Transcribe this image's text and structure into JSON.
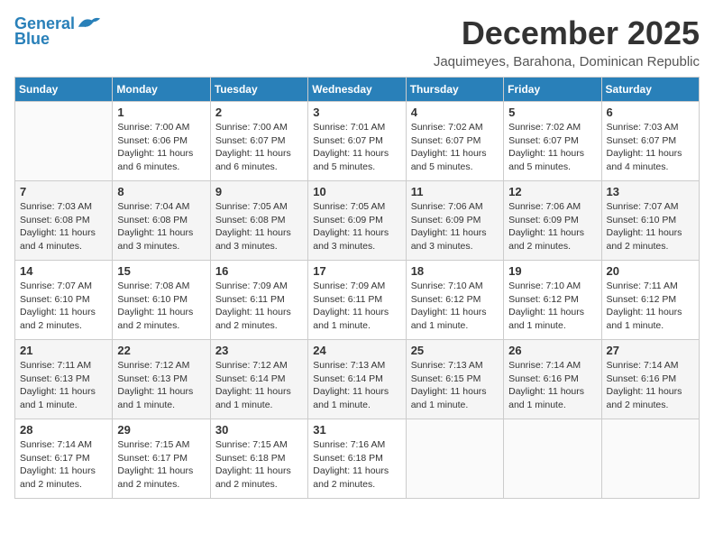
{
  "logo": {
    "line1": "General",
    "line2": "Blue"
  },
  "title": "December 2025",
  "subtitle": "Jaquimeyes, Barahona, Dominican Republic",
  "days_header": [
    "Sunday",
    "Monday",
    "Tuesday",
    "Wednesday",
    "Thursday",
    "Friday",
    "Saturday"
  ],
  "weeks": [
    [
      {
        "day": "",
        "info": ""
      },
      {
        "day": "1",
        "info": "Sunrise: 7:00 AM\nSunset: 6:06 PM\nDaylight: 11 hours\nand 6 minutes."
      },
      {
        "day": "2",
        "info": "Sunrise: 7:00 AM\nSunset: 6:07 PM\nDaylight: 11 hours\nand 6 minutes."
      },
      {
        "day": "3",
        "info": "Sunrise: 7:01 AM\nSunset: 6:07 PM\nDaylight: 11 hours\nand 5 minutes."
      },
      {
        "day": "4",
        "info": "Sunrise: 7:02 AM\nSunset: 6:07 PM\nDaylight: 11 hours\nand 5 minutes."
      },
      {
        "day": "5",
        "info": "Sunrise: 7:02 AM\nSunset: 6:07 PM\nDaylight: 11 hours\nand 5 minutes."
      },
      {
        "day": "6",
        "info": "Sunrise: 7:03 AM\nSunset: 6:07 PM\nDaylight: 11 hours\nand 4 minutes."
      }
    ],
    [
      {
        "day": "7",
        "info": "Sunrise: 7:03 AM\nSunset: 6:08 PM\nDaylight: 11 hours\nand 4 minutes."
      },
      {
        "day": "8",
        "info": "Sunrise: 7:04 AM\nSunset: 6:08 PM\nDaylight: 11 hours\nand 3 minutes."
      },
      {
        "day": "9",
        "info": "Sunrise: 7:05 AM\nSunset: 6:08 PM\nDaylight: 11 hours\nand 3 minutes."
      },
      {
        "day": "10",
        "info": "Sunrise: 7:05 AM\nSunset: 6:09 PM\nDaylight: 11 hours\nand 3 minutes."
      },
      {
        "day": "11",
        "info": "Sunrise: 7:06 AM\nSunset: 6:09 PM\nDaylight: 11 hours\nand 3 minutes."
      },
      {
        "day": "12",
        "info": "Sunrise: 7:06 AM\nSunset: 6:09 PM\nDaylight: 11 hours\nand 2 minutes."
      },
      {
        "day": "13",
        "info": "Sunrise: 7:07 AM\nSunset: 6:10 PM\nDaylight: 11 hours\nand 2 minutes."
      }
    ],
    [
      {
        "day": "14",
        "info": "Sunrise: 7:07 AM\nSunset: 6:10 PM\nDaylight: 11 hours\nand 2 minutes."
      },
      {
        "day": "15",
        "info": "Sunrise: 7:08 AM\nSunset: 6:10 PM\nDaylight: 11 hours\nand 2 minutes."
      },
      {
        "day": "16",
        "info": "Sunrise: 7:09 AM\nSunset: 6:11 PM\nDaylight: 11 hours\nand 2 minutes."
      },
      {
        "day": "17",
        "info": "Sunrise: 7:09 AM\nSunset: 6:11 PM\nDaylight: 11 hours\nand 1 minute."
      },
      {
        "day": "18",
        "info": "Sunrise: 7:10 AM\nSunset: 6:12 PM\nDaylight: 11 hours\nand 1 minute."
      },
      {
        "day": "19",
        "info": "Sunrise: 7:10 AM\nSunset: 6:12 PM\nDaylight: 11 hours\nand 1 minute."
      },
      {
        "day": "20",
        "info": "Sunrise: 7:11 AM\nSunset: 6:12 PM\nDaylight: 11 hours\nand 1 minute."
      }
    ],
    [
      {
        "day": "21",
        "info": "Sunrise: 7:11 AM\nSunset: 6:13 PM\nDaylight: 11 hours\nand 1 minute."
      },
      {
        "day": "22",
        "info": "Sunrise: 7:12 AM\nSunset: 6:13 PM\nDaylight: 11 hours\nand 1 minute."
      },
      {
        "day": "23",
        "info": "Sunrise: 7:12 AM\nSunset: 6:14 PM\nDaylight: 11 hours\nand 1 minute."
      },
      {
        "day": "24",
        "info": "Sunrise: 7:13 AM\nSunset: 6:14 PM\nDaylight: 11 hours\nand 1 minute."
      },
      {
        "day": "25",
        "info": "Sunrise: 7:13 AM\nSunset: 6:15 PM\nDaylight: 11 hours\nand 1 minute."
      },
      {
        "day": "26",
        "info": "Sunrise: 7:14 AM\nSunset: 6:16 PM\nDaylight: 11 hours\nand 1 minute."
      },
      {
        "day": "27",
        "info": "Sunrise: 7:14 AM\nSunset: 6:16 PM\nDaylight: 11 hours\nand 2 minutes."
      }
    ],
    [
      {
        "day": "28",
        "info": "Sunrise: 7:14 AM\nSunset: 6:17 PM\nDaylight: 11 hours\nand 2 minutes."
      },
      {
        "day": "29",
        "info": "Sunrise: 7:15 AM\nSunset: 6:17 PM\nDaylight: 11 hours\nand 2 minutes."
      },
      {
        "day": "30",
        "info": "Sunrise: 7:15 AM\nSunset: 6:18 PM\nDaylight: 11 hours\nand 2 minutes."
      },
      {
        "day": "31",
        "info": "Sunrise: 7:16 AM\nSunset: 6:18 PM\nDaylight: 11 hours\nand 2 minutes."
      },
      {
        "day": "",
        "info": ""
      },
      {
        "day": "",
        "info": ""
      },
      {
        "day": "",
        "info": ""
      }
    ]
  ]
}
